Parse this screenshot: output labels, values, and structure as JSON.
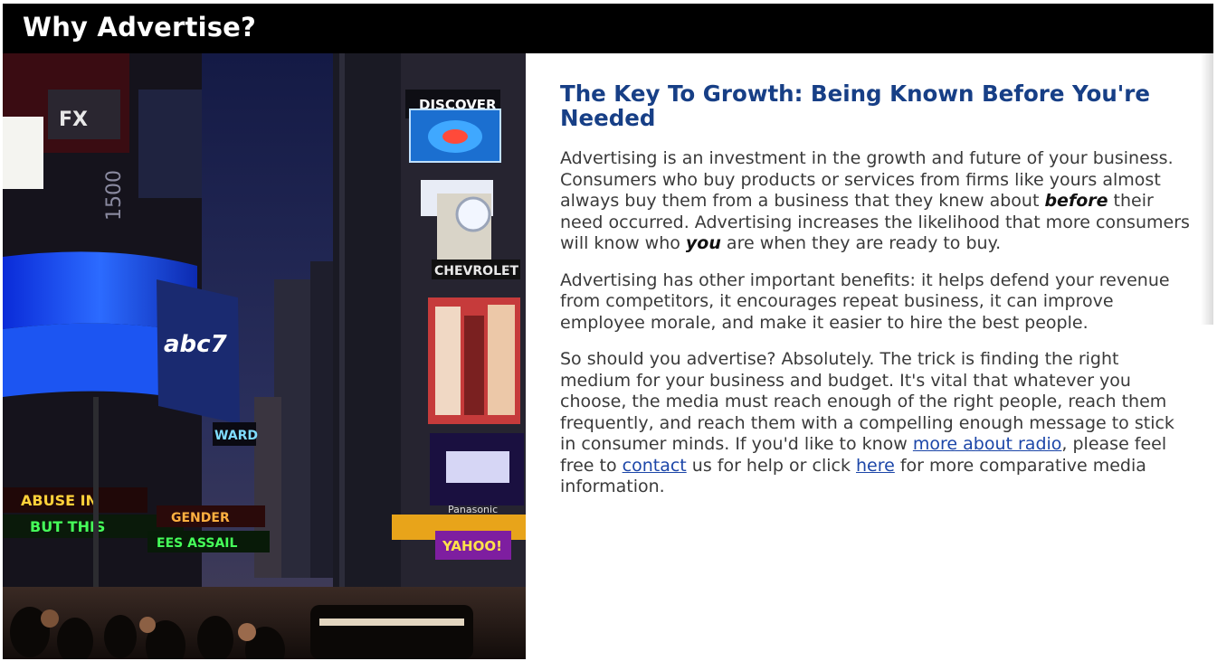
{
  "header": {
    "title": "Why Advertise?"
  },
  "photo": {
    "description_alt": "Times Square at night",
    "signs": {
      "discover": "DISCOVER",
      "chevrolet": "CHEVROLET",
      "abc": "abc7",
      "fx": "FX",
      "ward": "WARD",
      "panasonic": "Panasonic",
      "yahoo": "YAHOO!",
      "ticker1": "ABUSE IN",
      "ticker2": "BUT THIS",
      "ticker3": "GENDER",
      "ticker4": "EES ASSAIL",
      "number": "1500"
    }
  },
  "article": {
    "heading": "The Key To Growth: Being Known Before You're Needed",
    "p1": {
      "a": "Advertising is an investment in the growth and future of your business. Consumers who buy products or services from firms like yours almost always buy them from a business that they knew about ",
      "em1": "before",
      "b": " their need occurred. Advertising increases the likelihood that more consumers will know who ",
      "em2": "you",
      "c": " are when they are ready to buy."
    },
    "p2": "Advertising has other important benefits:  it helps defend your revenue from competitors, it encourages repeat business, it can improve employee morale, and make it easier to hire the best people.",
    "p3": {
      "a": "So should you advertise?  Absolutely.  The trick is finding the right medium for your business and budget.  It's vital that whatever you choose, the media must reach enough of the right people, reach them frequently, and reach them with a compelling enough message to stick in consumer minds.  If you'd like to know ",
      "link_radio": "more about radio",
      "b": ", please feel free to ",
      "link_contact": "contact",
      "c": " us for help or click ",
      "link_here": "here",
      "d": " for more comparative media information."
    }
  },
  "colors": {
    "header_bg": "#000000",
    "heading": "#173f86",
    "body_text": "#3a3a3a",
    "link": "#1c46a8"
  }
}
